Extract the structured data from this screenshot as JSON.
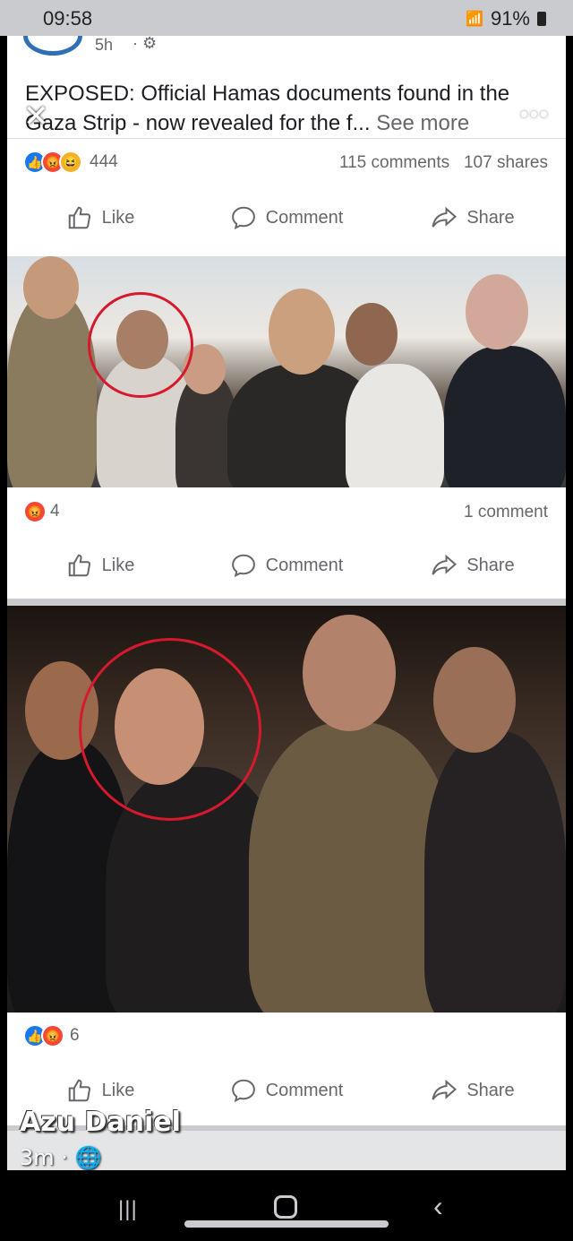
{
  "status": {
    "time": "09:58",
    "battery": "91%"
  },
  "post": {
    "time": "5h",
    "headline": "EXPOSED: Official Hamas documents found in the Gaza Strip - now revealed for the f...",
    "see_more": "See more",
    "reaction_count": "444",
    "comments": "115 comments",
    "shares": "107 shares"
  },
  "photo1": {
    "reaction_count": "4",
    "comments": "1 comment"
  },
  "photo2": {
    "reaction_count": "6"
  },
  "actions": {
    "like": "Like",
    "comment": "Comment",
    "share": "Share"
  },
  "overlay": {
    "name": "Azu Daniel",
    "time": "3m"
  },
  "colors": {
    "like_blue": "#1877f2",
    "angry": "#f0493a",
    "haha": "#f7b125",
    "circle_red": "#d7192d"
  }
}
